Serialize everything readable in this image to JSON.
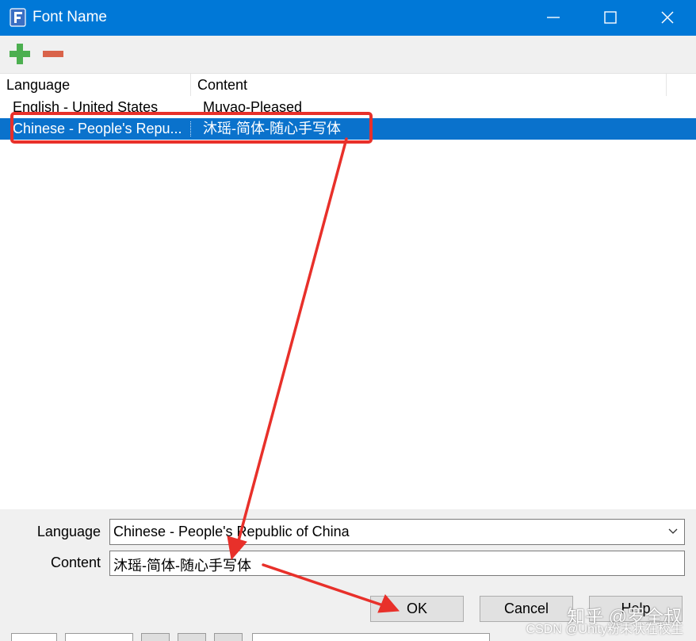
{
  "window": {
    "title": "Font Name"
  },
  "colors": {
    "titlebar": "#0078d7",
    "selection": "#0a72cc",
    "annotation": "#e8302a",
    "add": "#4caf50",
    "remove": "#d9634a"
  },
  "toolbar": {
    "add_icon": "plus-icon",
    "remove_icon": "minus-icon"
  },
  "list": {
    "columns": [
      "Language",
      "Content"
    ],
    "rows": [
      {
        "language": "English - United States",
        "content": "Muyao-Pleased",
        "selected": false
      },
      {
        "language": "Chinese - People's Repu...",
        "content": "沐瑶-简体-随心手写体",
        "selected": true
      }
    ]
  },
  "form": {
    "language_label": "Language",
    "language_value": "Chinese - People's Republic of China",
    "content_label": "Content",
    "content_value": "沐瑶-简体-随心手写体"
  },
  "buttons": {
    "ok": "OK",
    "cancel": "Cancel",
    "help": "Help"
  },
  "watermark": {
    "zhihu": "知乎 @罗全叔",
    "csdn": "CSDN @Unity粉末状在校生"
  }
}
